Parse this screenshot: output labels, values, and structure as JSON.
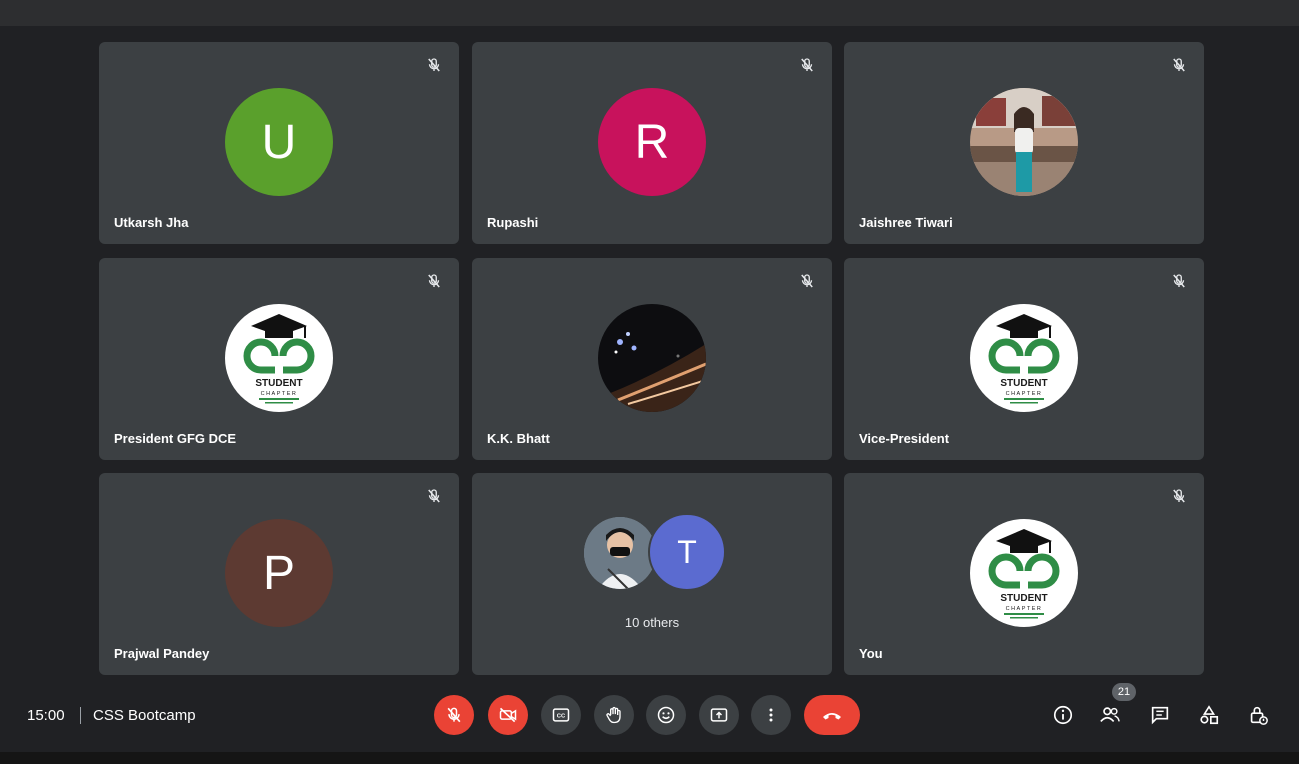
{
  "participants": [
    {
      "name": "Utkarsh Jha",
      "initial": "U",
      "color": "#5aa02c",
      "type": "initial",
      "muted": true
    },
    {
      "name": "Rupashi",
      "initial": "R",
      "color": "#c8125c",
      "type": "initial",
      "muted": true
    },
    {
      "name": "Jaishree Tiwari",
      "type": "photo",
      "muted": true
    },
    {
      "name": "President GFG DCE",
      "type": "gfg-logo",
      "muted": true
    },
    {
      "name": "K.K. Bhatt",
      "type": "photo",
      "muted": true
    },
    {
      "name": "Vice-President",
      "type": "gfg-logo",
      "muted": true
    },
    {
      "name": "Prajwal Pandey",
      "initial": "P",
      "color": "#5d3a32",
      "type": "initial",
      "muted": true
    },
    {
      "name": "10 others",
      "type": "group",
      "initial": "T",
      "color": "#5b6bd0"
    },
    {
      "name": "You",
      "type": "gfg-logo",
      "muted": true
    }
  ],
  "logo": {
    "text1": "STUDENT",
    "text2": "CHAPTER"
  },
  "meeting": {
    "time": "15:00",
    "title": "CSS Bootcamp"
  },
  "people_count": "21",
  "colors": {
    "tile": "#3c4043",
    "background": "#202124",
    "danger": "#ea4335",
    "gfg_green": "#2f8d46"
  },
  "controls": [
    "mic-off-icon",
    "camera-off-icon",
    "captions-icon",
    "raise-hand-icon",
    "emoji-icon",
    "present-screen-icon",
    "more-options-icon",
    "leave-call-icon"
  ],
  "right_icons": [
    "info-icon",
    "people-icon",
    "chat-icon",
    "activities-icon",
    "host-controls-icon"
  ]
}
